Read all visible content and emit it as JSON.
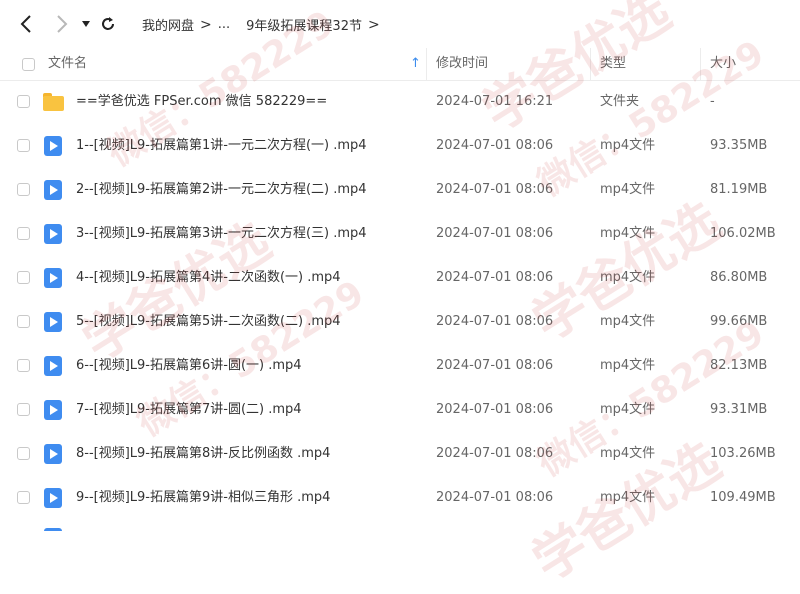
{
  "nav": {
    "breadcrumbs": [
      "我的网盘",
      "...",
      "9年级拓展课程32节"
    ]
  },
  "header": {
    "name": "文件名",
    "modified": "修改时间",
    "type": "类型",
    "size": "大小"
  },
  "files": [
    {
      "name": "==学爸优选 FPSer.com 微信 582229==",
      "modified": "2024-07-01 16:21",
      "type": "文件夹",
      "size": "-",
      "icon": "folder-icon"
    },
    {
      "name": "1--[视频]L9-拓展篇第1讲-一元二次方程(一) .mp4",
      "modified": "2024-07-01 08:06",
      "type": "mp4文件",
      "size": "93.35MB",
      "icon": "video-file-icon"
    },
    {
      "name": "2--[视频]L9-拓展篇第2讲-一元二次方程(二) .mp4",
      "modified": "2024-07-01 08:06",
      "type": "mp4文件",
      "size": "81.19MB",
      "icon": "video-file-icon"
    },
    {
      "name": "3--[视频]L9-拓展篇第3讲-一元二次方程(三) .mp4",
      "modified": "2024-07-01 08:06",
      "type": "mp4文件",
      "size": "106.02MB",
      "icon": "video-file-icon"
    },
    {
      "name": "4--[视频]L9-拓展篇第4讲-二次函数(一) .mp4",
      "modified": "2024-07-01 08:06",
      "type": "mp4文件",
      "size": "86.80MB",
      "icon": "video-file-icon"
    },
    {
      "name": "5--[视频]L9-拓展篇第5讲-二次函数(二) .mp4",
      "modified": "2024-07-01 08:06",
      "type": "mp4文件",
      "size": "99.66MB",
      "icon": "video-file-icon"
    },
    {
      "name": "6--[视频]L9-拓展篇第6讲-圆(一) .mp4",
      "modified": "2024-07-01 08:06",
      "type": "mp4文件",
      "size": "82.13MB",
      "icon": "video-file-icon"
    },
    {
      "name": "7--[视频]L9-拓展篇第7讲-圆(二) .mp4",
      "modified": "2024-07-01 08:06",
      "type": "mp4文件",
      "size": "93.31MB",
      "icon": "video-file-icon"
    },
    {
      "name": "8--[视频]L9-拓展篇第8讲-反比例函数 .mp4",
      "modified": "2024-07-01 08:06",
      "type": "mp4文件",
      "size": "103.26MB",
      "icon": "video-file-icon"
    },
    {
      "name": "9--[视频]L9-拓展篇第9讲-相似三角形 .mp4",
      "modified": "2024-07-01 08:06",
      "type": "mp4文件",
      "size": "109.49MB",
      "icon": "video-file-icon"
    }
  ],
  "watermark": {
    "text_brand": "学爸优选",
    "text_wechat": "微信：582229",
    "color": "#c83c3c"
  }
}
